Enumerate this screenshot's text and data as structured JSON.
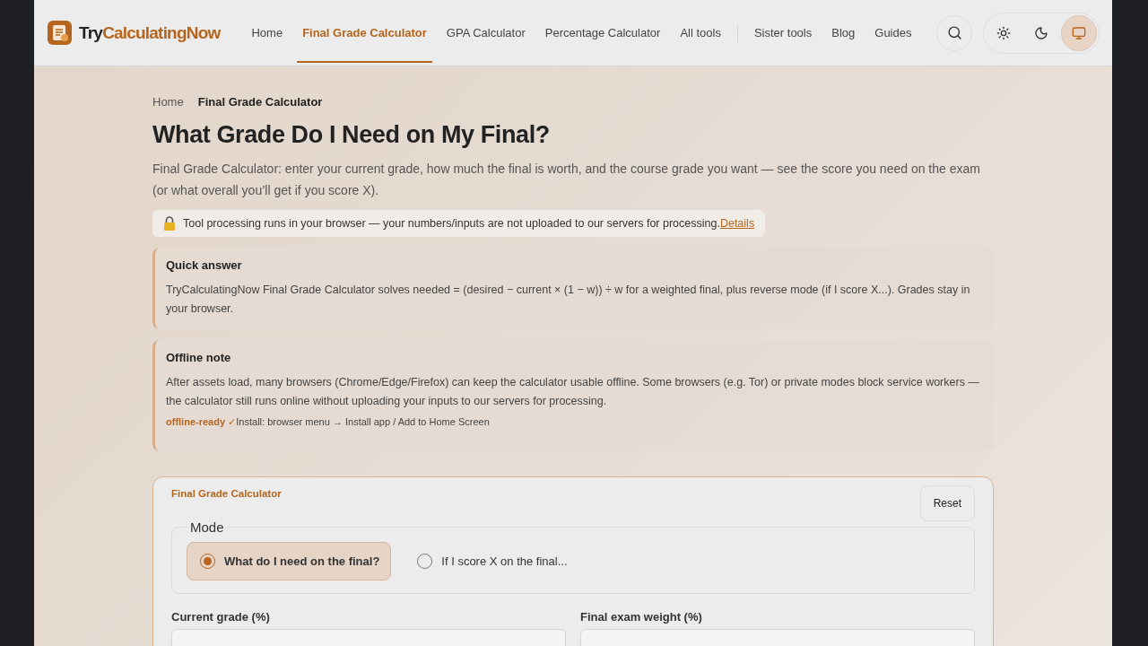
{
  "brand": {
    "name_part_1": "Try",
    "name_part_2": "CalculatingNow"
  },
  "nav": [
    {
      "label": "Home",
      "selected": false
    },
    {
      "label": "Final Grade Calculator",
      "selected": true
    },
    {
      "label": "GPA Calculator",
      "selected": false
    },
    {
      "label": "Percentage Calculator",
      "selected": false
    },
    {
      "label": "All tools",
      "selected": false
    }
  ],
  "nav_secondary": [
    {
      "label": "Sister tools"
    },
    {
      "label": "Blog"
    },
    {
      "label": "Guides"
    }
  ],
  "theme_buttons": [
    {
      "kind": "light",
      "selected": false
    },
    {
      "kind": "dark",
      "selected": false
    },
    {
      "kind": "system",
      "selected": true
    }
  ],
  "breadcrumb": [
    "Home",
    "Final Grade Calculator"
  ],
  "title": "What Grade Do I Need on My Final?",
  "intro": "Final Grade Calculator: enter your current grade, how much the final is worth, and the course grade you want — see the score you need on the exam (or what overall you’ll get if you score X).",
  "privacy": {
    "text": "Tool processing runs in your browser — your numbers/inputs are not uploaded to our servers for processing.",
    "link": "Details"
  },
  "notes": [
    {
      "title": "Quick answer",
      "body": "TryCalculatingNow Final Grade Calculator solves needed = (desired − current × (1 − w)) ÷ w for a weighted final, plus reverse mode (if I score X...). Grades stay in your browser."
    },
    {
      "title": "Offline note",
      "body": "After assets load, many browsers (Chrome/Edge/Firefox) can keep the calculator usable offline. Some browsers (e.g. Tor) or private modes block service workers — the calculator still runs online without uploading your inputs to our servers for processing.",
      "badge": "offline-ready ✓",
      "hint": "Install: browser menu → Install app / Add to Home Screen"
    }
  ],
  "calculator": {
    "title": "Final Grade Calculator",
    "reset": "Reset",
    "mode_legend": "Mode",
    "modes": [
      {
        "label": "What do I need on the final?",
        "selected": true
      },
      {
        "label": "If I score X on the final...",
        "selected": false
      }
    ],
    "fields": [
      {
        "label": "Current grade (%)"
      },
      {
        "label": "Final exam weight (%)"
      }
    ]
  }
}
